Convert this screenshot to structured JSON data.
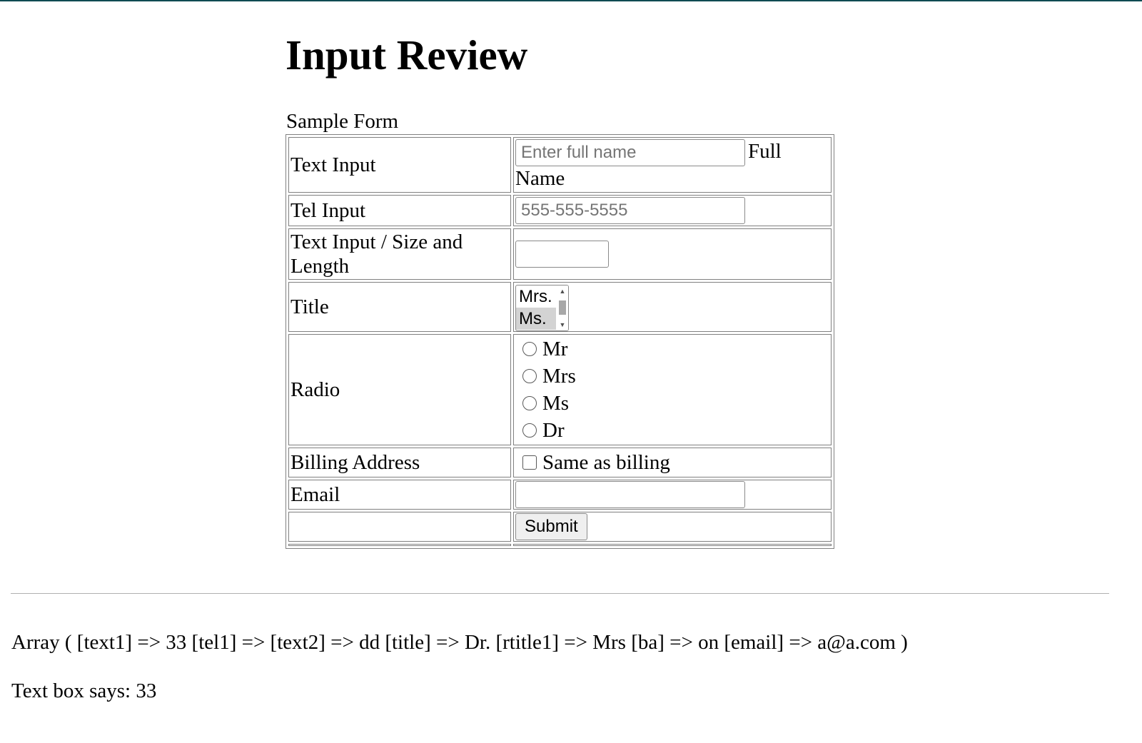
{
  "page": {
    "title": "Input Review",
    "form_caption": "Sample Form"
  },
  "form": {
    "text_input": {
      "label": "Text Input",
      "placeholder": "Enter full name",
      "value": "",
      "suffix": "Full Name"
    },
    "tel_input": {
      "label": "Tel Input",
      "placeholder": "555-555-5555",
      "value": ""
    },
    "size_input": {
      "label": "Text Input / Size and Length",
      "value": ""
    },
    "title_select": {
      "label": "Title",
      "visible_options": [
        "Mrs.",
        "Ms."
      ],
      "highlighted": "Ms."
    },
    "radio": {
      "label": "Radio",
      "options": [
        "Mr",
        "Mrs",
        "Ms",
        "Dr"
      ]
    },
    "billing": {
      "label": "Billing Address",
      "checkbox_label": "Same as billing",
      "checked": false
    },
    "email": {
      "label": "Email",
      "value": ""
    },
    "submit_label": "Submit"
  },
  "results": {
    "array_dump": "Array ( [text1] => 33 [tel1] => [text2] => dd [title] => Dr. [rtitle1] => Mrs [ba] => on [email] => a@a.com )",
    "text_box_says": "Text box says: 33"
  },
  "colors": {
    "top_border": "#0f4b52",
    "table_border": "#808080",
    "selected_option_bg": "#d3d3d3",
    "button_bg": "#efefef"
  }
}
